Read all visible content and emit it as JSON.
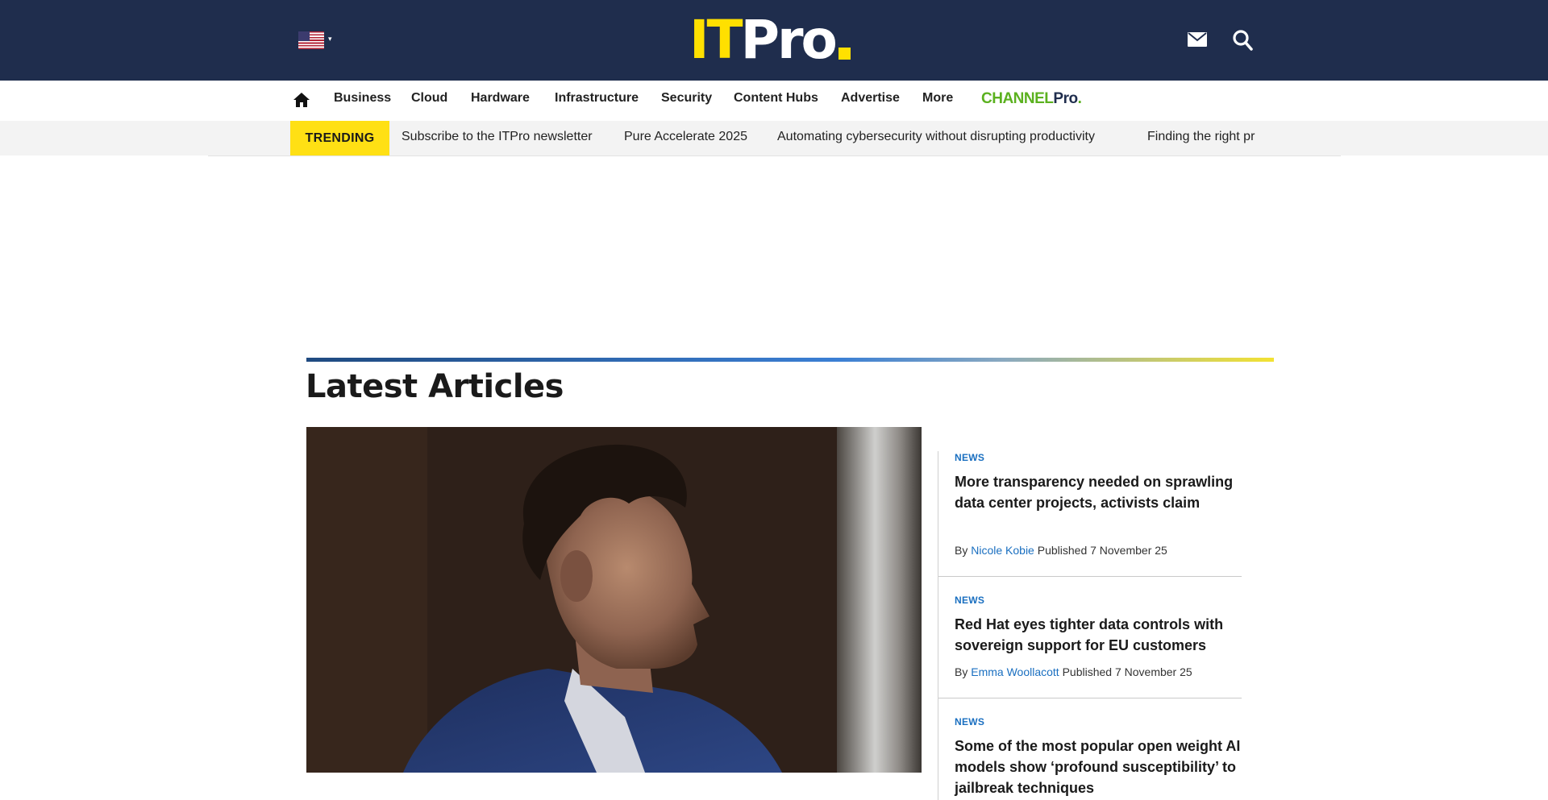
{
  "header": {
    "logo_it": "IT",
    "logo_pro": "Pro",
    "region_caret": "▾",
    "icons": {
      "flag": "us-flag-icon",
      "mail": "mail-icon",
      "search": "search-icon"
    },
    "colors": {
      "header_bg": "#1f2d4d",
      "logo_accent": "#ffe000"
    }
  },
  "nav": {
    "home_icon": "home-icon",
    "items": [
      "Business",
      "Cloud",
      "Hardware",
      "Infrastructure",
      "Security",
      "Content Hubs",
      "Advertise",
      "More"
    ],
    "channelpro": {
      "channel": "CHANNEL",
      "pro": "Pro",
      "dot": "."
    }
  },
  "trending": {
    "label": "TRENDING",
    "links": [
      "Subscribe to the ITPro newsletter",
      "Pure Accelerate 2025",
      "Automating cybersecurity without disrupting productivity",
      "Finding the right pr"
    ],
    "badge_color": "#ffe014"
  },
  "latest": {
    "title": "Latest Articles",
    "articles": [
      {
        "label": "NEWS",
        "headline": "More transparency needed on sprawling data center projects, activists claim",
        "by": "By",
        "author": "Nicole Kobie",
        "published": "Published 7 November 25"
      },
      {
        "label": "NEWS",
        "headline": "Red Hat eyes tighter data controls with sovereign support for EU customers",
        "by": "By",
        "author": "Emma Woollacott",
        "published": "Published 7 November 25"
      },
      {
        "label": "NEWS",
        "headline": "Some of the most popular open weight AI models show ‘profound susceptibility’ to jailbreak techniques",
        "by": "",
        "author": "",
        "published": ""
      }
    ],
    "link_color": "#1a6fc0"
  }
}
